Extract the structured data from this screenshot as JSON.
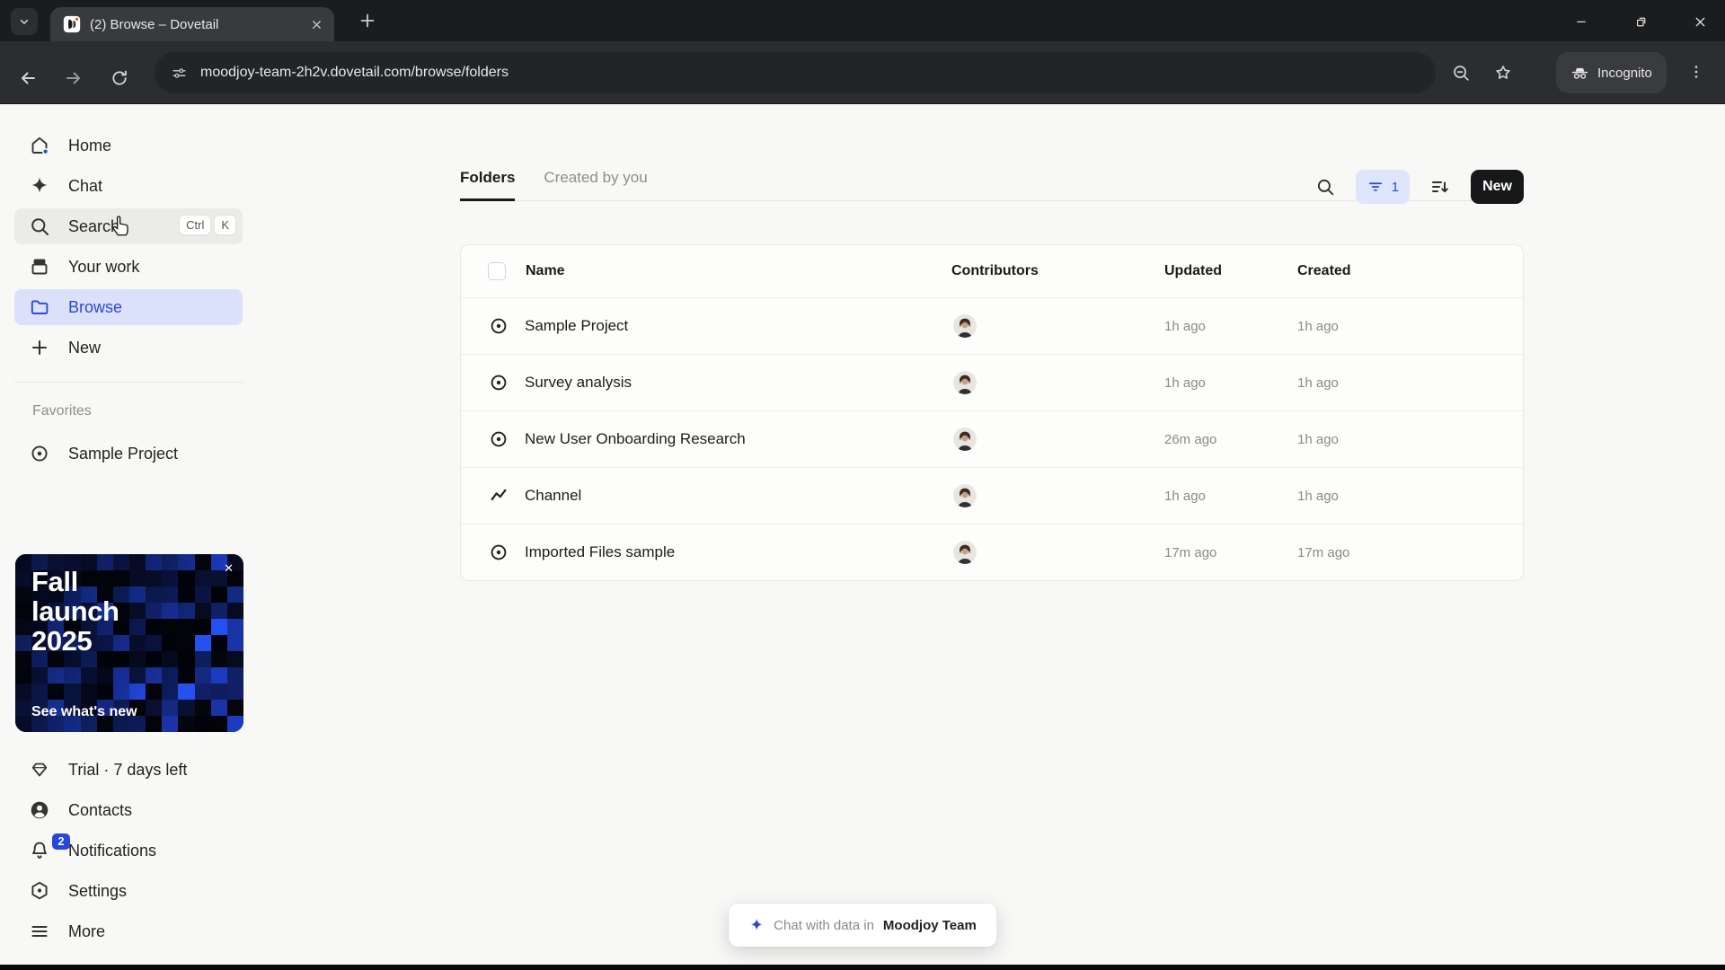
{
  "browser": {
    "tab_title": "(2) Browse – Dovetail",
    "url": "moodjoy-team-2h2v.dovetail.com/browse/folders",
    "incognito_label": "Incognito"
  },
  "sidebar": {
    "items": [
      {
        "label": "Home"
      },
      {
        "label": "Chat"
      },
      {
        "label": "Search",
        "shortcut_keys": [
          "Ctrl",
          "K"
        ]
      },
      {
        "label": "Your work"
      },
      {
        "label": "Browse"
      },
      {
        "label": "New"
      }
    ],
    "favorites_heading": "Favorites",
    "favorites": [
      {
        "label": "Sample Project"
      }
    ],
    "promo": {
      "line1": "Fall",
      "line2": "launch",
      "line3": "2025",
      "cta": "See what's new",
      "close": "✕"
    },
    "bottom_items": [
      {
        "label": "Trial · 7 days left"
      },
      {
        "label": "Contacts"
      },
      {
        "label": "Notifications",
        "badge": "2"
      },
      {
        "label": "Settings"
      },
      {
        "label": "More"
      }
    ]
  },
  "main": {
    "tab_folders": "Folders",
    "tab_created_by_you": "Created by you",
    "filter_count": "1",
    "new_button": "New",
    "table": {
      "headers": {
        "name": "Name",
        "contributors": "Contributors",
        "updated": "Updated",
        "created": "Created"
      },
      "rows": [
        {
          "name": "Sample Project",
          "icon": "target",
          "updated": "1h ago",
          "created": "1h ago"
        },
        {
          "name": "Survey analysis",
          "icon": "target",
          "updated": "1h ago",
          "created": "1h ago"
        },
        {
          "name": "New User Onboarding Research",
          "icon": "target",
          "updated": "26m ago",
          "created": "1h ago"
        },
        {
          "name": "Channel",
          "icon": "zigzag",
          "updated": "1h ago",
          "created": "1h ago"
        },
        {
          "name": "Imported Files sample",
          "icon": "target",
          "updated": "17m ago",
          "created": "17m ago"
        }
      ]
    },
    "toast": {
      "prefix": "Chat with data in",
      "team": "Moodjoy Team"
    }
  },
  "colors": {
    "accent": "#2b49d8",
    "selected_bg": "#dbe1fb",
    "promo_palette": [
      "#05060d",
      "#0a1032",
      "#142a80",
      "#1c3cc0",
      "#2450f0",
      "#0b1548",
      "#03040a",
      "#101f66",
      "#0d1d5e",
      "#060b20",
      "#1a34a8",
      "#02030a"
    ]
  }
}
